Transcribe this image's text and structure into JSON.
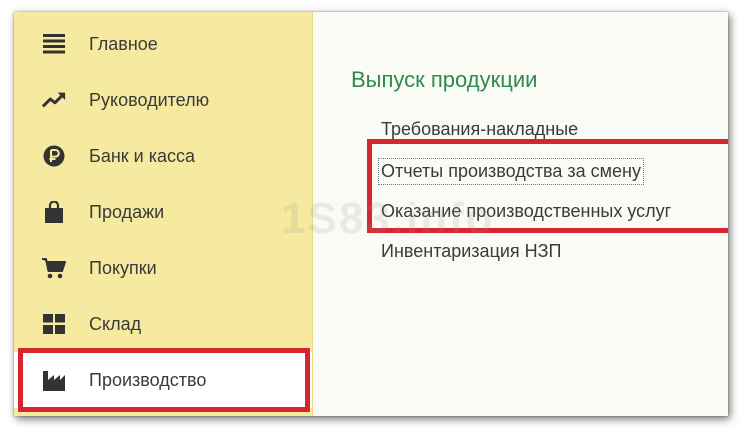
{
  "sidebar": {
    "items": [
      {
        "label": "Главное",
        "icon": "menu-lines-icon"
      },
      {
        "label": "Руководителю",
        "icon": "trend-icon"
      },
      {
        "label": "Банк и касса",
        "icon": "ruble-coin-icon"
      },
      {
        "label": "Продажи",
        "icon": "shopping-bag-icon"
      },
      {
        "label": "Покупки",
        "icon": "cart-icon"
      },
      {
        "label": "Склад",
        "icon": "warehouse-grid-icon"
      },
      {
        "label": "Производство",
        "icon": "factory-icon"
      }
    ],
    "active_item": "Производство"
  },
  "main": {
    "section_title": "Выпуск продукции",
    "links": [
      "Требования-накладные",
      "Отчеты производства за смену",
      "Оказание производственных услуг",
      "Инвентаризация НЗП"
    ]
  },
  "watermark": "1S83.info",
  "colors": {
    "sidebar_bg": "#f6e9a0",
    "section_title": "#2e8a4e",
    "highlight": "#d8262f"
  }
}
